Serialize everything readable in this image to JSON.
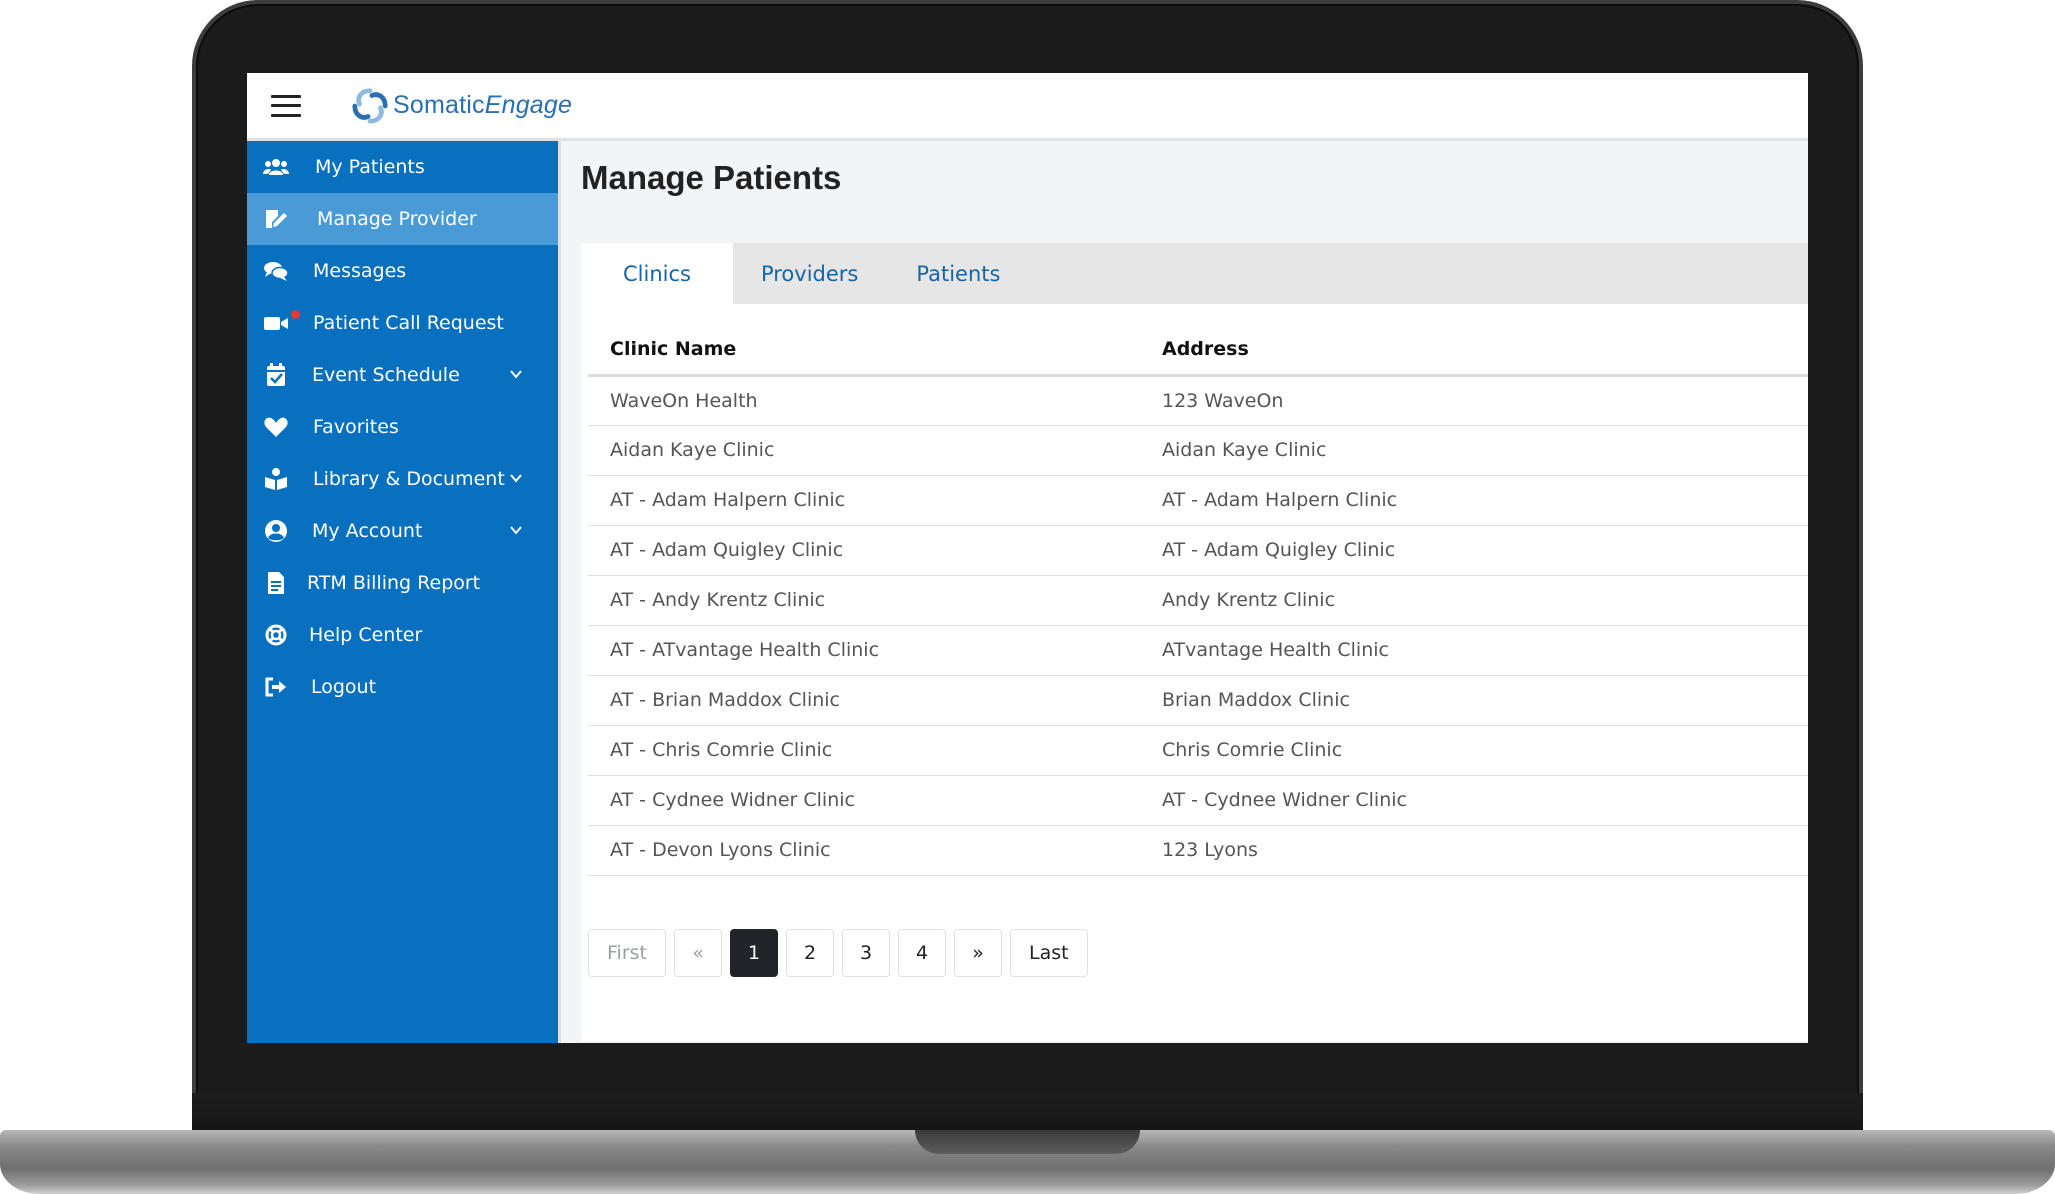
{
  "brand": {
    "name_main": "Somatic",
    "name_em": "Engage"
  },
  "sidebar": {
    "items": [
      {
        "label": "My Patients",
        "icon": "users-icon",
        "active": false
      },
      {
        "label": "Manage Provider",
        "icon": "edit-document-icon",
        "active": true
      },
      {
        "label": "Messages",
        "icon": "chat-bubbles-icon",
        "active": false
      },
      {
        "label": "Patient Call Request",
        "icon": "video-camera-icon",
        "active": false
      },
      {
        "label": "Event Schedule",
        "icon": "calendar-check-icon",
        "active": false
      },
      {
        "label": "Favorites",
        "icon": "heart-icon",
        "active": false
      },
      {
        "label": "Library & Document",
        "icon": "reader-icon",
        "active": false
      },
      {
        "label": "My Account",
        "icon": "user-circle-icon",
        "active": false
      },
      {
        "label": "RTM Billing Report",
        "icon": "file-report-icon",
        "active": false
      },
      {
        "label": "Help Center",
        "icon": "life-ring-icon",
        "active": false
      },
      {
        "label": "Logout",
        "icon": "sign-out-icon",
        "active": false
      }
    ]
  },
  "main": {
    "title": "Manage Patients",
    "tabs": [
      "Clinics",
      "Providers",
      "Patients"
    ],
    "table": {
      "headers": [
        "Clinic Name",
        "Address"
      ],
      "rows": [
        [
          "WaveOn Health",
          "123 WaveOn"
        ],
        [
          "Aidan Kaye Clinic",
          "Aidan Kaye Clinic"
        ],
        [
          "AT - Adam Halpern Clinic",
          "AT - Adam Halpern Clinic"
        ],
        [
          "AT - Adam Quigley Clinic",
          "AT - Adam Quigley Clinic"
        ],
        [
          "AT - Andy Krentz Clinic",
          "Andy Krentz Clinic"
        ],
        [
          "AT - ATvantage Health Clinic",
          "ATvantage Health Clinic"
        ],
        [
          "AT - Brian Maddox Clinic",
          "Brian Maddox Clinic"
        ],
        [
          "AT - Chris Comrie Clinic",
          "Chris Comrie Clinic"
        ],
        [
          "AT - Cydnee Widner Clinic",
          "AT - Cydnee Widner Clinic"
        ],
        [
          "AT - Devon Lyons Clinic",
          "123 Lyons"
        ]
      ]
    },
    "pagination": {
      "first": "First",
      "prev": "«",
      "pages": [
        "1",
        "2",
        "3",
        "4"
      ],
      "current": "1",
      "next": "»",
      "last": "Last"
    }
  },
  "colors": {
    "sidebar_bg": "#0870bf",
    "sidebar_active": "#4a9ad6",
    "tab_text": "#1565a6",
    "page_active": "#212529",
    "alert_dot": "#e53935"
  }
}
